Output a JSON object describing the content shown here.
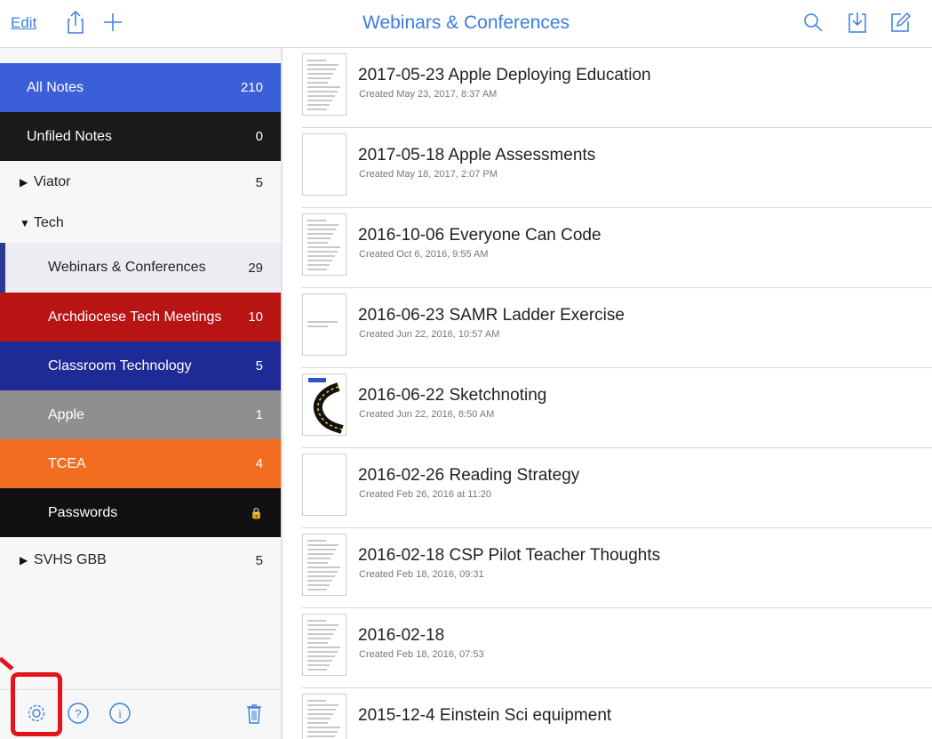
{
  "toolbar": {
    "edit_label": "Edit",
    "title": "Webinars & Conferences",
    "icons": [
      "share-icon",
      "plus-icon",
      "search-icon",
      "import-icon",
      "compose-icon"
    ]
  },
  "sidebar": {
    "items": [
      {
        "label": "All Notes",
        "count": "210",
        "kind": "colored",
        "bg": "#3a5fd9",
        "fg": "#ffffff"
      },
      {
        "label": "Unfiled Notes",
        "count": "0",
        "kind": "colored",
        "bg": "#1a1a1a",
        "fg": "#ffffff"
      },
      {
        "label": "Viator",
        "count": "5",
        "kind": "group",
        "triangle": "▶"
      },
      {
        "label": "Tech",
        "count": "",
        "kind": "group",
        "triangle": "▼"
      },
      {
        "label": "Webinars & Conferences",
        "count": "29",
        "kind": "selected",
        "bg": "#ecedf3",
        "fg": "#222222"
      },
      {
        "label": "Archdiocese Tech Meetings",
        "count": "10",
        "kind": "sub",
        "bg": "#b81414",
        "fg": "#ffffff"
      },
      {
        "label": "Classroom Technology",
        "count": "5",
        "kind": "sub",
        "bg": "#1e2b96",
        "fg": "#ffffff"
      },
      {
        "label": "Apple",
        "count": "1",
        "kind": "sub",
        "bg": "#8f8f8f",
        "fg": "#ffffff"
      },
      {
        "label": "TCEA",
        "count": "4",
        "kind": "sub",
        "bg": "#f36d21",
        "fg": "#ffffff"
      },
      {
        "label": "Passwords",
        "count": "🔒",
        "kind": "sub",
        "bg": "#111111",
        "fg": "#ffffff"
      },
      {
        "label": "SVHS GBB",
        "count": "5",
        "kind": "group",
        "triangle": "▶"
      }
    ],
    "footer_icons": [
      "settings-icon",
      "help-icon",
      "info-icon",
      "trash-icon"
    ]
  },
  "notes": [
    {
      "title": "2017-05-23 Apple Deploying Education",
      "created": "Created May 23, 2017, 8:37 AM",
      "thumb": "doc"
    },
    {
      "title": "2017-05-18 Apple Assessments",
      "created": "Created May 18, 2017, 2:07 PM",
      "thumb": "blank"
    },
    {
      "title": "2016-10-06 Everyone Can Code",
      "created": "Created Oct 6, 2016, 9:55 AM",
      "thumb": "doc"
    },
    {
      "title": "2016-06-23 SAMR Ladder Exercise",
      "created": "Created Jun 22, 2016, 10:57 AM",
      "thumb": "wide"
    },
    {
      "title": "2016-06-22 Sketchnoting",
      "created": "Created Jun 22, 2016, 8:50 AM",
      "thumb": "sketch"
    },
    {
      "title": "2016-02-26 Reading Strategy",
      "created": "Created Feb 26, 2016 at 11:20",
      "thumb": "blank"
    },
    {
      "title": "2016-02-18 CSP Pilot Teacher Thoughts",
      "created": "Created Feb 18, 2016, 09:31",
      "thumb": "doc"
    },
    {
      "title": "2016-02-18",
      "created": "Created Feb 18, 2016, 07:53",
      "thumb": "doc"
    },
    {
      "title": "2015-12-4 Einstein Sci equipment",
      "created": "",
      "thumb": "doc"
    }
  ]
}
